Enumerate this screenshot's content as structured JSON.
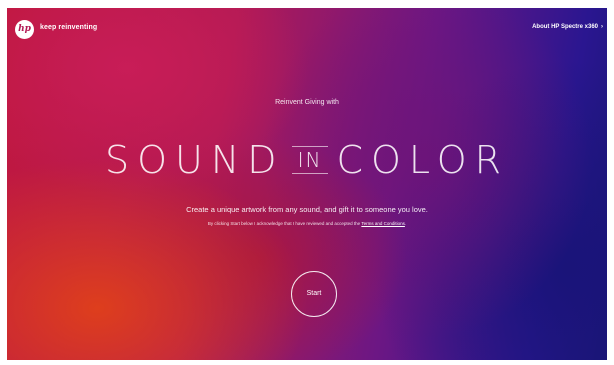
{
  "header": {
    "logo_text": "hp",
    "tagline": "keep reinventing",
    "about_link": "About HP Spectre x360",
    "about_chevron": "›"
  },
  "hero": {
    "intro": "Reinvent Giving with",
    "title_word1": "SOUND",
    "title_word2": "IN",
    "title_word3": "COLOR",
    "subtitle": "Create a unique artwork from any sound, and gift it to someone you love.",
    "terms_prefix": "By clicking Start below I acknowledge that I have reviewed and accepted the",
    "terms_link": "Terms and Conditions",
    "terms_suffix": ".",
    "start_label": "Start"
  },
  "colors": {
    "magenta": "#b21a55",
    "red_orange": "#e0401a",
    "purple": "#6c1784",
    "deep_blue": "#1a1675"
  },
  "icons": {
    "logo": "hp-logo-icon",
    "chevron": "chevron-right-icon"
  }
}
